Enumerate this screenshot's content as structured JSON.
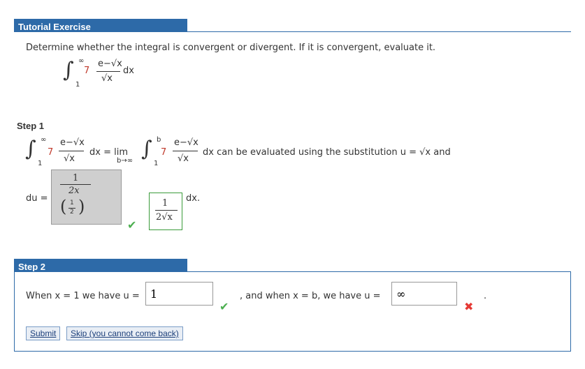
{
  "header": {
    "title": "Tutorial Exercise"
  },
  "problem": {
    "prompt": "Determine whether the integral is convergent or divergent. If it is convergent, evaluate it.",
    "coef": "7",
    "upper": "∞",
    "lower": "1",
    "numerator": "e−√x",
    "denominator": "√x",
    "dx": "dx"
  },
  "step1": {
    "title": "Step 1",
    "equals_lim": "dx  =  lim",
    "lim_sub": "b→∞",
    "upper_b": "b",
    "after_text": "dx  can be evaluated using the substitution  u  =  √x  and",
    "du_label": "du =",
    "wrong_answer": {
      "num": "1",
      "den": "2x",
      "small_num": "1",
      "small_den": "2"
    },
    "correct_answer": {
      "num": "1",
      "den": "2√x"
    },
    "dx_after": "dx."
  },
  "step2": {
    "title": "Step 2",
    "when1": "When  x  =  1  we have  u  =",
    "answer1": "1",
    "when2": ",  and when  x  =  b,  we have  u  =",
    "answer2": "∞",
    "period": "."
  },
  "buttons": {
    "submit": "Submit",
    "skip": "Skip (you cannot come back)"
  },
  "colors": {
    "header_bg": "#2d6aa8",
    "check": "#4caf50",
    "cross": "#e53935",
    "coef": "#c0392b"
  }
}
